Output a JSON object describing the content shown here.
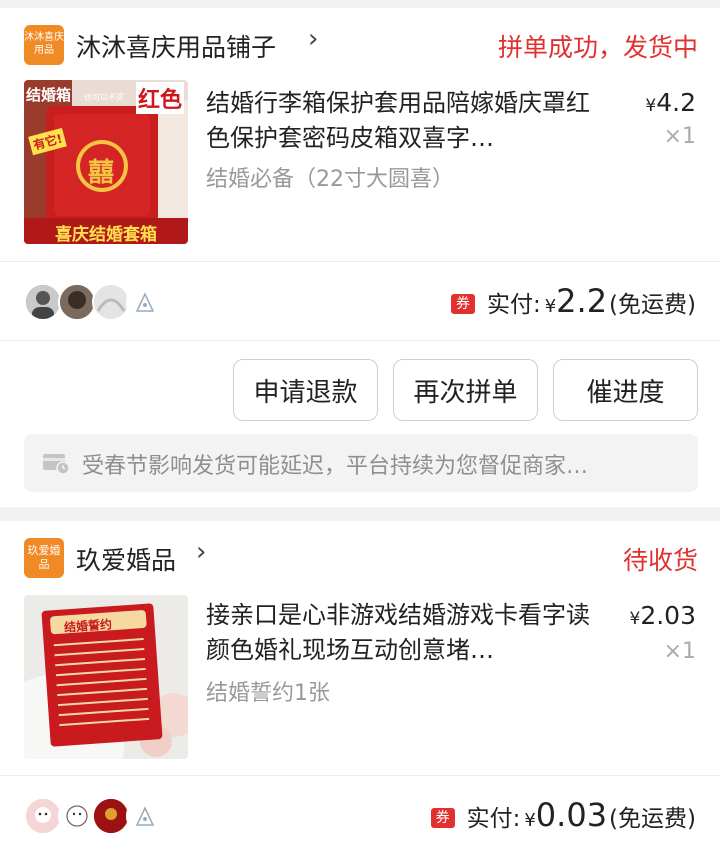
{
  "orders": [
    {
      "shop": {
        "logo_text": "沐沐喜庆用品",
        "name": "沐沐喜庆用品铺子",
        "arrow": "›"
      },
      "status": "拼单成功，发货中",
      "product": {
        "title": "结婚行李箱保护套用品陪嫁婚庆罩红色保护套密码皮箱双喜字…",
        "sku": "结婚必备（22寸大圆喜）",
        "price_symbol": "¥",
        "price": "4.2",
        "quantity": "×1",
        "image_text": {
          "top": "结婚箱",
          "small": "也可以不买",
          "color": "红色",
          "tag": "有它!",
          "xi": "囍",
          "banner": "喜庆结婚套箱"
        }
      },
      "payment": {
        "coupon": "券",
        "label": "实付:",
        "symbol": "¥",
        "amount": "2.2",
        "note": "(免运费)"
      },
      "actions": [
        "申请退款",
        "再次拼单",
        "催进度"
      ],
      "notice": "受春节影响发货可能延迟，平台持续为您督促商家…"
    },
    {
      "shop": {
        "logo_text": "玖爱婚品",
        "name": "玖爱婚品",
        "arrow": "›"
      },
      "status": "待收货",
      "product": {
        "title": "接亲口是心非游戏结婚游戏卡看字读颜色婚礼现场互动创意堵…",
        "sku": "结婚誓约1张",
        "price_symbol": "¥",
        "price": "2.03",
        "quantity": "×1",
        "image_text": {
          "banner": "结婚誓约"
        }
      },
      "payment": {
        "coupon": "券",
        "label": "实付:",
        "symbol": "¥",
        "amount": "0.03",
        "note": "(免运费)"
      }
    }
  ],
  "colors": {
    "accent_red": "#e0312f",
    "shop_logo": "#f08a24",
    "muted": "#999999"
  },
  "icons": [
    "chevron-right-icon",
    "notice-truck-icon",
    "coupon-badge-icon"
  ]
}
